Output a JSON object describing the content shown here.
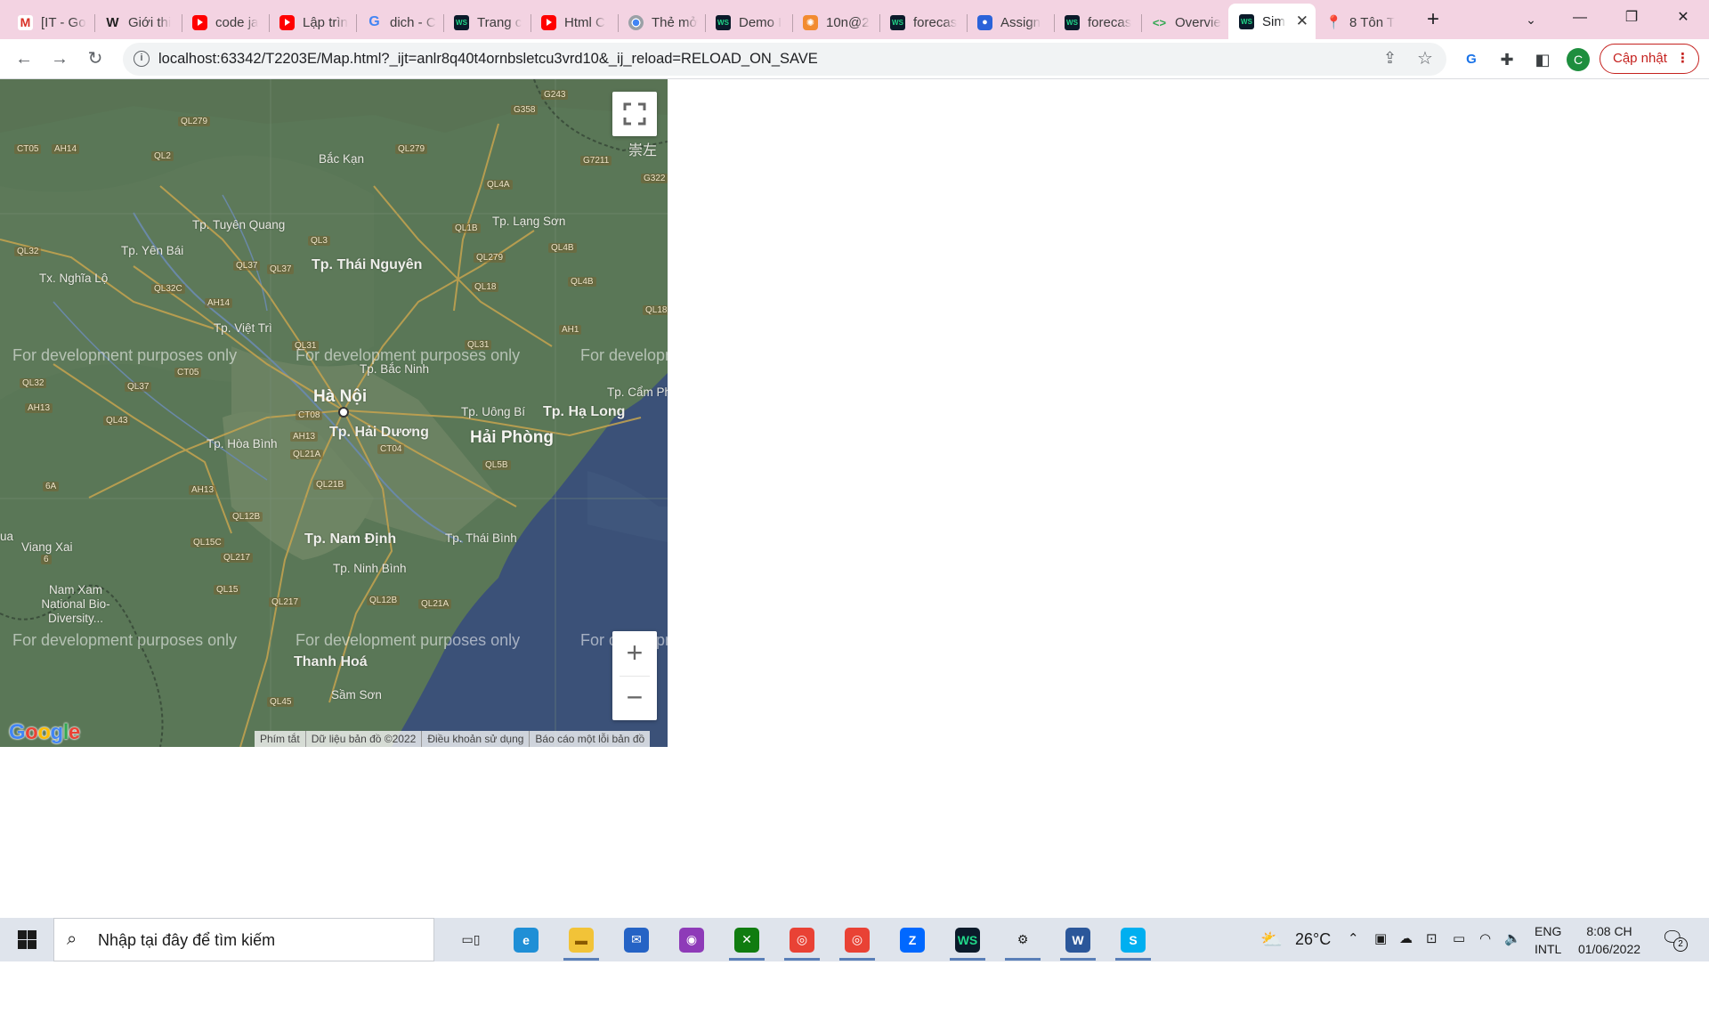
{
  "browser": {
    "tabs": [
      {
        "title": "[IT - Go",
        "favicon": "gmail-icon"
      },
      {
        "title": "Giới thi",
        "favicon": "w3-icon"
      },
      {
        "title": "code ja",
        "favicon": "youtube-icon"
      },
      {
        "title": "Lập trìn",
        "favicon": "youtube-icon"
      },
      {
        "title": "dich - C",
        "favicon": "google-icon"
      },
      {
        "title": "Trang c",
        "favicon": "webstorm-icon"
      },
      {
        "title": "Html C",
        "favicon": "youtube-icon"
      },
      {
        "title": "Thẻ mở",
        "favicon": "chrome-icon"
      },
      {
        "title": "Demo I",
        "favicon": "webstorm-icon"
      },
      {
        "title": "10n@2",
        "favicon": "orange-app-icon"
      },
      {
        "title": "forecas",
        "favicon": "webstorm-icon"
      },
      {
        "title": "Assign",
        "favicon": "contacts-icon"
      },
      {
        "title": "forecas",
        "favicon": "webstorm-icon"
      },
      {
        "title": "Overvie",
        "favicon": "code-icon"
      },
      {
        "title": "Sim",
        "favicon": "webstorm-icon",
        "active": true
      },
      {
        "title": "8 Tôn T",
        "favicon": "maps-pin-icon"
      }
    ],
    "new_tab_label": "+",
    "url": "localhost:63342/T2203E/Map.html?_ijt=anlr8q40t4ornbsletcu3vrd10&_ij_reload=RELOAD_ON_SAVE",
    "avatar_letter": "C",
    "update_label": "Cập nhật"
  },
  "map": {
    "watermark": "For development purposes only",
    "attribution": [
      "Phím tắt",
      "Dữ liệu bản đồ ©2022",
      "Điều khoản sử dụng",
      "Báo cáo một lỗi bản đồ"
    ],
    "logo": "Google",
    "zoom_in": "+",
    "zoom_out": "−",
    "labels": {
      "hanoi": "Hà Nội",
      "haiphong": "Hải Phòng",
      "thainguyen": "Tp. Thái Nguyên",
      "namdinh": "Tp. Nam Định",
      "thanhhoa": "Thanh Hoá",
      "haiduong": "Tp. Hải Dương",
      "halong": "Tp. Hạ Long",
      "langson": "Tp. Lạng Sơn",
      "backan": "Bắc Kạn",
      "tuyenquang": "Tp. Tuyên Quang",
      "yenbai": "Tp. Yên Bái",
      "nghialo": "Tx. Nghĩa Lộ",
      "viettri": "Tp. Việt Trì",
      "bacninh": "Tp. Bắc Ninh",
      "uongbi": "Tp. Uông Bí",
      "camph": "Tp. Cẩm Ph",
      "hoabinh": "Tp. Hòa Bình",
      "thaibinh": "Tp. Thái Bình",
      "ninhbinh": "Tp. Ninh Bình",
      "vietxai": "Viang Xai",
      "namxam": "Nam Xam National Bio-Diversity...",
      "samson": "Sầm Sơn",
      "ua": "ua",
      "chinese": "崇左"
    },
    "shields": [
      "QL279",
      "CT05",
      "AH14",
      "QL2",
      "QL279",
      "G358",
      "G243",
      "G7211",
      "G322",
      "QL4A",
      "QL1B",
      "QL279",
      "QL3",
      "QL37",
      "QL37",
      "QL32",
      "QL32C",
      "AH14",
      "QL4B",
      "QL4B",
      "QL18",
      "AH1",
      "QL31",
      "QL31",
      "CT05",
      "QL32",
      "QL37",
      "AH13",
      "QL43",
      "CT08",
      "AH13",
      "QL21A",
      "CT04",
      "QL5B",
      "QL21B",
      "AH13",
      "QL12B",
      "QL15C",
      "QL217",
      "QL15",
      "QL217",
      "QL12B",
      "QL21A",
      "QL45",
      "6A",
      "6",
      "QL18"
    ]
  },
  "taskbar": {
    "search_placeholder": "Nhập tại đây để tìm kiếm",
    "weather": "26°C",
    "lang_line1": "ENG",
    "lang_line2": "INTL",
    "time": "8:08 CH",
    "date": "01/06/2022",
    "notification_count": "2",
    "apps": [
      "task-view-icon",
      "edge-icon",
      "file-explorer-icon",
      "mail-icon",
      "camera-app-icon",
      "xbox-icon",
      "chrome-icon",
      "chrome-icon",
      "zalo-icon",
      "webstorm-icon",
      "settings-icon",
      "word-icon",
      "skype-icon"
    ]
  }
}
